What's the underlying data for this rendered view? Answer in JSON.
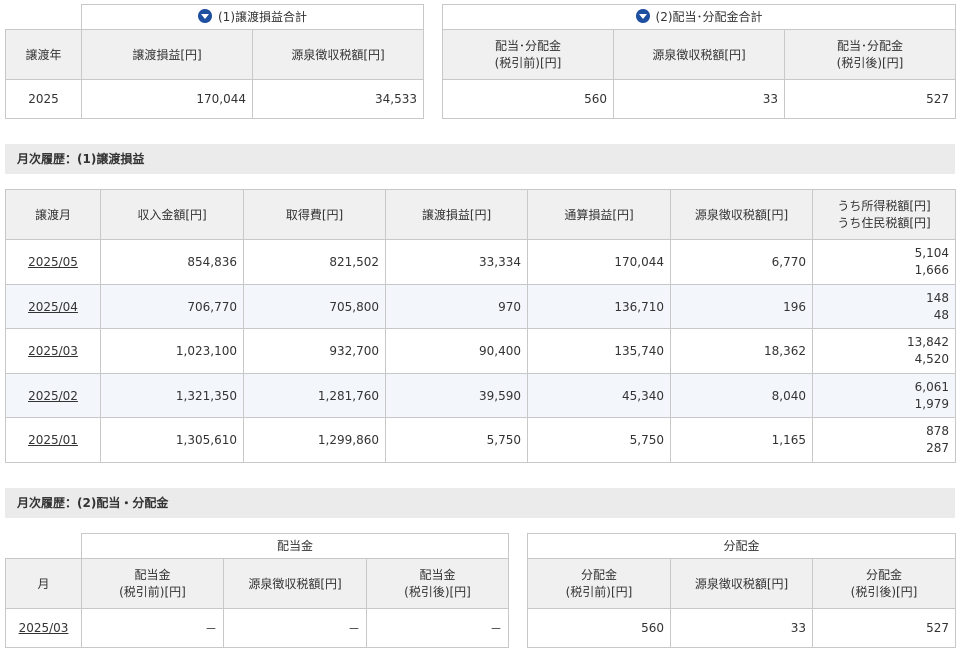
{
  "summary_transfer": {
    "group_title": "(1)譲渡損益合計",
    "headers": [
      "譲渡年",
      "譲渡損益[円]",
      "源泉徴収税額[円]"
    ],
    "row": [
      "2025",
      "170,044",
      "34,533"
    ]
  },
  "summary_dividend": {
    "group_title": "(2)配当･分配金合計",
    "headers": [
      "配当･分配金\n(税引前)[円]",
      "源泉徴収税額[円]",
      "配当･分配金\n(税引後)[円]"
    ],
    "row": [
      "560",
      "33",
      "527"
    ]
  },
  "section1_title": "月次履歴：(1)譲渡損益",
  "monthly_transfer": {
    "headers": [
      "譲渡月",
      "収入金額[円]",
      "取得費[円]",
      "譲渡損益[円]",
      "通算損益[円]",
      "源泉徴収税額[円]",
      "うち所得税額[円]\nうち住民税額[円]"
    ],
    "rows": [
      [
        "2025/05",
        "854,836",
        "821,502",
        "33,334",
        "170,044",
        "6,770",
        "5,104",
        "1,666"
      ],
      [
        "2025/04",
        "706,770",
        "705,800",
        "970",
        "136,710",
        "196",
        "148",
        "48"
      ],
      [
        "2025/03",
        "1,023,100",
        "932,700",
        "90,400",
        "135,740",
        "18,362",
        "13,842",
        "4,520"
      ],
      [
        "2025/02",
        "1,321,350",
        "1,281,760",
        "39,590",
        "45,340",
        "8,040",
        "6,061",
        "1,979"
      ],
      [
        "2025/01",
        "1,305,610",
        "1,299,860",
        "5,750",
        "5,750",
        "1,165",
        "878",
        "287"
      ]
    ]
  },
  "section2_title": "月次履歴：(2)配当・分配金",
  "monthly_dividend": {
    "group_haitou": "配当金",
    "group_bunpai": "分配金",
    "month_header": "月",
    "haitou_headers": [
      "配当金\n(税引前)[円]",
      "源泉徴収税額[円]",
      "配当金\n(税引後)[円]"
    ],
    "bunpai_headers": [
      "分配金\n(税引前)[円]",
      "源泉徴収税額[円]",
      "分配金\n(税引後)[円]"
    ],
    "row": [
      "2025/03",
      "－",
      "－",
      "－",
      "560",
      "33",
      "527"
    ]
  }
}
